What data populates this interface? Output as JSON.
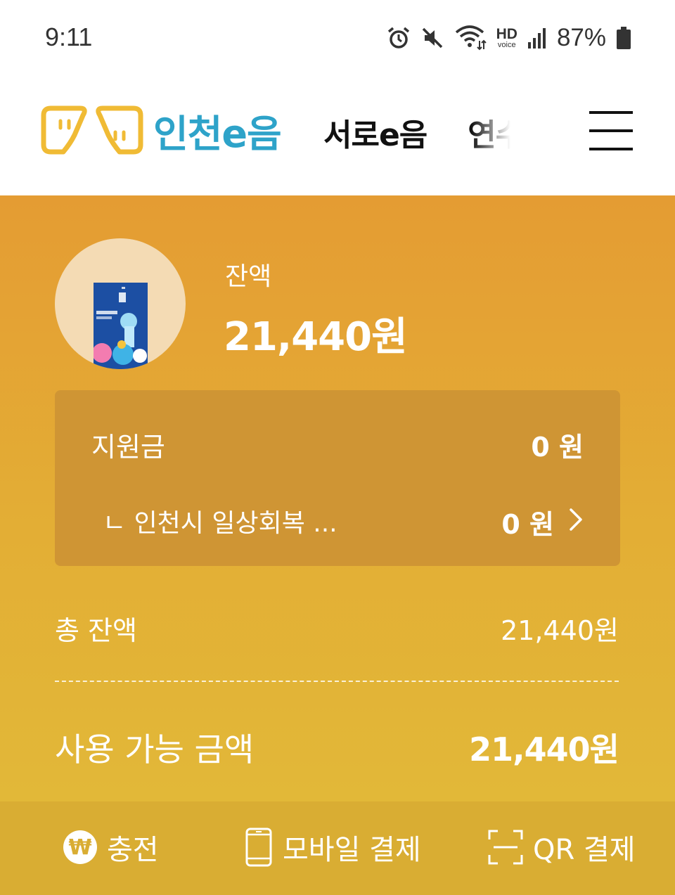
{
  "status_bar": {
    "time": "9:11",
    "hd_top": "HD",
    "hd_bottom": "voice",
    "battery": "87%"
  },
  "header": {
    "logo_text": "인천e음",
    "tabs": [
      {
        "label": "서로e음"
      },
      {
        "label": "연수"
      }
    ],
    "menu_icon": "hamburger-icon"
  },
  "balance": {
    "label": "잔액",
    "amount": "21,440원"
  },
  "subsidy": {
    "label": "지원금",
    "value": "0 원",
    "sub_item_label": "ㄴ 인천시 일상회복 ...",
    "sub_item_value": "0 원"
  },
  "total": {
    "label": "총 잔액",
    "value": "21,440원"
  },
  "available": {
    "label": "사용 가능 금액",
    "value": "21,440원"
  },
  "actions": {
    "charge": {
      "label": "충전",
      "icon": "won-icon",
      "icon_glyph": "₩"
    },
    "mobile_pay": {
      "label": "모바일 결제",
      "icon": "phone-icon"
    },
    "qr_pay": {
      "label": "QR 결제",
      "icon": "qr-scan-icon"
    }
  },
  "colors": {
    "panel_top": "#e49c33",
    "panel_bottom": "#e2b838",
    "subsidy_box": "#cf9534",
    "action_bar": "#d9ad33",
    "logo_blue": "#2ea3c9",
    "logo_yellow": "#f0bb35"
  }
}
